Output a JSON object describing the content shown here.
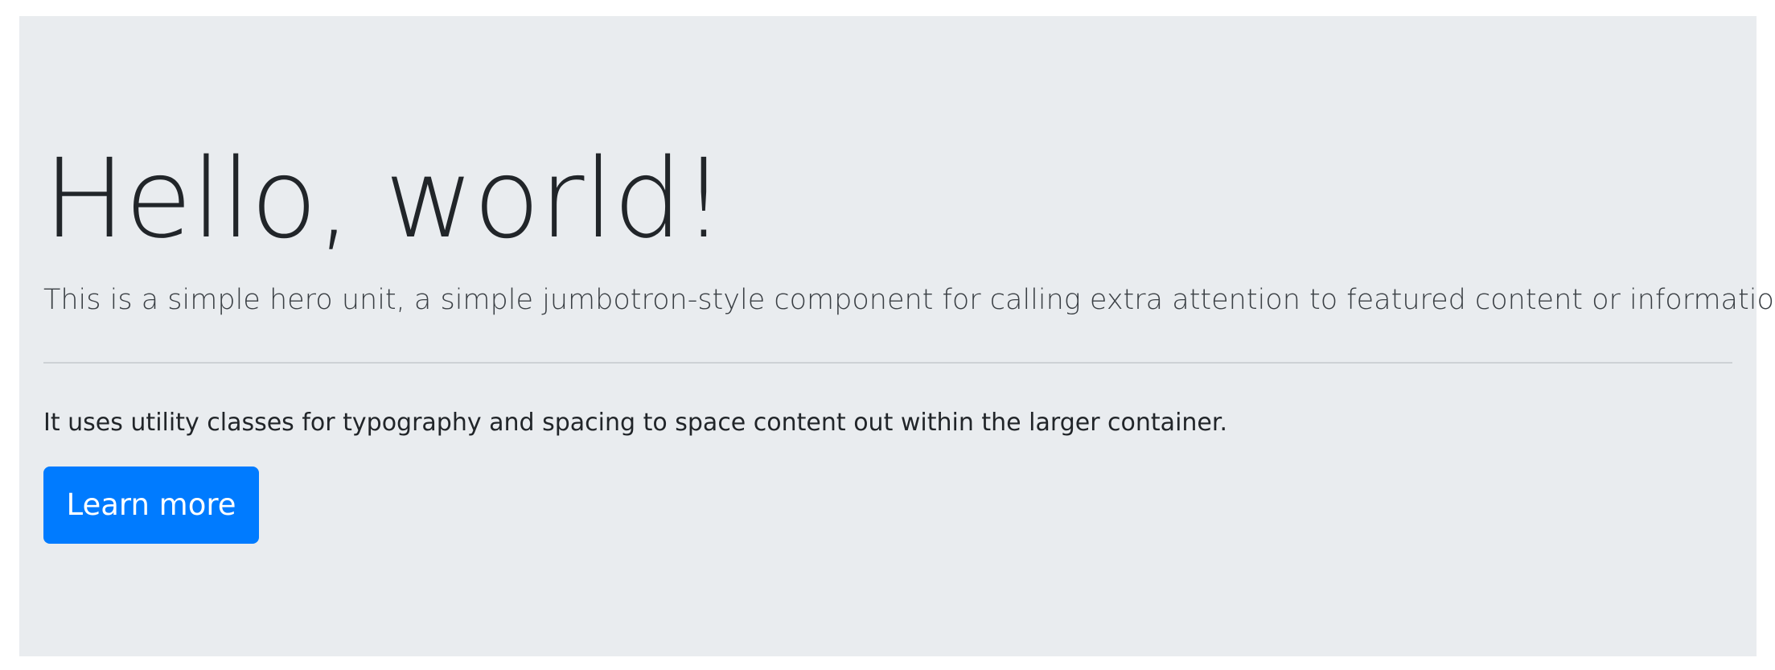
{
  "hero": {
    "title": "Hello, world!",
    "lead": "This is a simple hero unit, a simple jumbotron-style component for calling extra attention to featured content or information.",
    "body": "It uses utility classes for typography and spacing to space content out within the larger container.",
    "button_label": "Learn more"
  },
  "colors": {
    "background": "#e9ecef",
    "primary": "#007bff",
    "text": "#212529"
  }
}
